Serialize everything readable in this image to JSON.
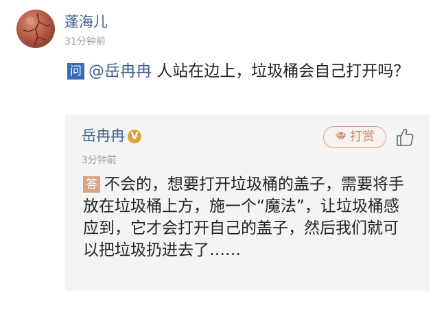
{
  "post": {
    "asker_name": "蓬海儿",
    "asker_time": "31分钟前",
    "question_badge": "问",
    "mention": "@岳冉冉",
    "question_text": " 人站在边上，垃圾桶会自己打开吗？"
  },
  "answer": {
    "name": "岳冉冉",
    "verified_badge": "V",
    "tip_label": "打赏",
    "time": "3分钟前",
    "badge": "答",
    "text": "不会的，想要打开垃圾桶的盖子，需要将手放在垃圾桶上方，施一个“魔法”，让垃圾桶感应到，它才会打开自己的盖子，然后我们就可以把垃圾扔进去了……"
  },
  "icons": {
    "like": "thumbs-up-icon",
    "tip": "diamond-icon",
    "avatar": "avatar-image"
  },
  "colors": {
    "name_blue": "#3d5f8f",
    "question_badge": "#3b6bb8",
    "answer_badge": "#d9a285",
    "card_bg": "#f4f4f4",
    "tip_accent": "#c8826b",
    "verified_gold": "#d9a637"
  }
}
